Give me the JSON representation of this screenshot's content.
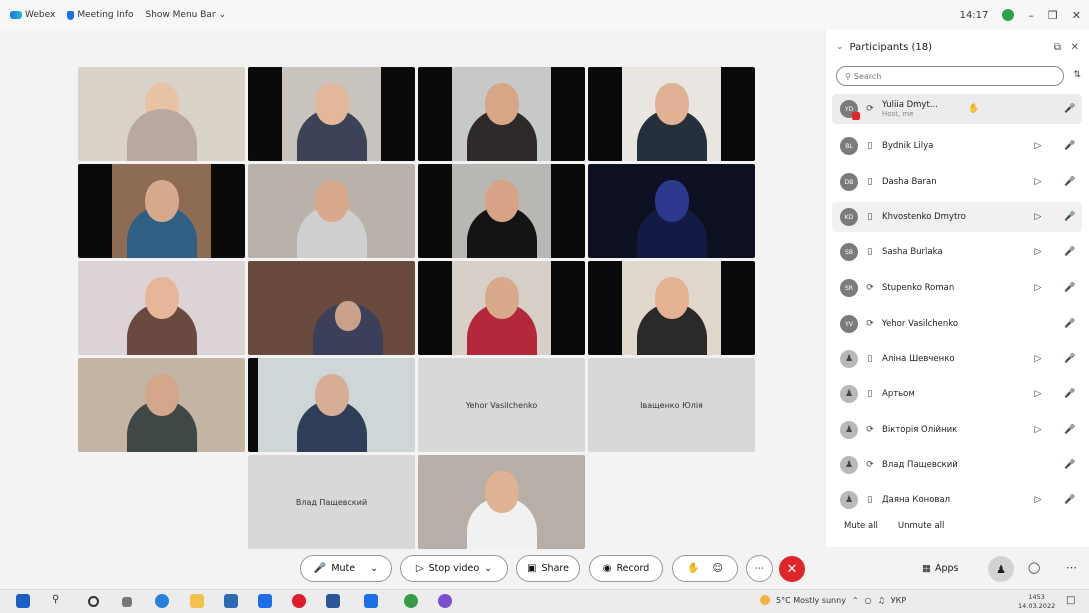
{
  "titlebar": {
    "app_name": "Webex",
    "meeting_info": "Meeting Info",
    "show_menu_bar": "Show Menu Bar",
    "time": "14:17"
  },
  "video_grid": {
    "name_tiles": [
      "Yehor Vasilchenko",
      "Іващенко Юлія",
      "Влад Пащевский"
    ]
  },
  "participants_panel": {
    "title": "Participants (18)",
    "search_placeholder": "Search",
    "participants": [
      {
        "initials": "YD",
        "name": "Yuliia Dmyt...",
        "subtitle": "Host, me"
      },
      {
        "initials": "BL",
        "name": "Bydnik Lilya"
      },
      {
        "initials": "DB",
        "name": "Dasha Baran"
      },
      {
        "initials": "KD",
        "name": "Khvostenko Dmytro"
      },
      {
        "initials": "SB",
        "name": "Sasha Burlaka"
      },
      {
        "initials": "SR",
        "name": "Stupenko Roman"
      },
      {
        "initials": "YV",
        "name": "Yehor Vasilchenko"
      },
      {
        "initials": "",
        "name": "Аліна Шевченко"
      },
      {
        "initials": "",
        "name": "Артьом"
      },
      {
        "initials": "",
        "name": "Вікторія Олійник"
      },
      {
        "initials": "",
        "name": "Влад Пащевский"
      },
      {
        "initials": "",
        "name": "Даяна Коновал"
      }
    ],
    "mute_all": "Mute all",
    "unmute_all": "Unmute all"
  },
  "controls": {
    "mute": "Mute",
    "stop_video": "Stop video",
    "share": "Share",
    "record": "Record",
    "apps": "Apps"
  },
  "taskbar": {
    "weather": "5°C Mostly sunny",
    "language": "УКР",
    "clock_time": "1453",
    "clock_date": "14.03.2022"
  },
  "colors": {
    "end_call": "#e0252a",
    "webex_blue": "#1e6fe8",
    "mic_muted": "#d9262c",
    "mic_on": "#2ba24c"
  }
}
